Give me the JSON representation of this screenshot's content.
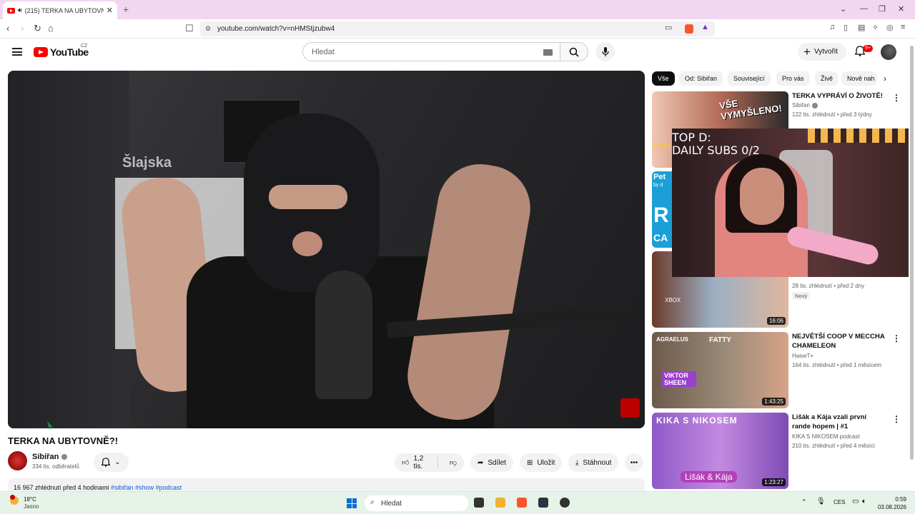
{
  "browser": {
    "tab_title": "(215) TERKA NA UBYTOVNĚ?!",
    "url": "youtube.com/watch?v=nHMStjzubw4"
  },
  "header": {
    "logo_text": "YouTube",
    "country_code": "CZ",
    "search_placeholder": "Hledat",
    "create_label": "Vytvořit",
    "notifications_count": "9+"
  },
  "video": {
    "title": "TERKA NA UBYTOVNĚ?!",
    "channel": "Sibiřan",
    "subscribers": "334 tis. odběratelů",
    "likes": "1,2 tis.",
    "share_label": "Sdílet",
    "save_label": "Uložit",
    "download_label": "Stáhnout",
    "views_time": "16 967 zhlédnutí  před 4 hodinami",
    "hashtags": "#sibiřan #show #podcast"
  },
  "chips": [
    "Vše",
    "Od: Sibiřan",
    "Související",
    "Pro vás",
    "Živě",
    "Nově nah"
  ],
  "recommendations": [
    {
      "title": "TERKA VYPRÁVÍ O ŽIVOTĚ!",
      "channel": "Sibiřan",
      "meta": "122 tis. zhlédnutí • před 3 týdny",
      "thumb_text": "VŠE VYMYŠLENO!",
      "thumb_side_text": "O DĚT"
    },
    {
      "thumb_text": "Pet",
      "thumb_big": "R",
      "thumb_sub": "CA",
      "thumb_by": "by d"
    },
    {
      "meta": "28 tis. zhlédnutí • před 2 dny",
      "badge": "Nový",
      "duration": "16:06",
      "thumb_text": "XBOX"
    },
    {
      "title": "NEJVĚTŠÍ COOP V MECCHA CHAMELEON",
      "channel": "HaiseT+",
      "meta": "164 tis. zhlédnutí • před 1 měsícem",
      "duration": "1:43:25",
      "thumb_label1": "AGRAELUS",
      "thumb_label2": "FATTY",
      "thumb_label3": "VIKTOR SHEEN"
    },
    {
      "title": "Lišák a Kája vzali první rande hopem | #1",
      "channel": "KIKA S NIKOSEM podcast",
      "meta": "210 tis. zhlédnutí • před 4 měsíci",
      "duration": "1:23:27",
      "thumb_text": "KIKA S NIKOSEM",
      "thumb_badge": "Lišák & Kája"
    }
  ],
  "stream_overlay": {
    "line1": "TOP D:",
    "line2": "DAILY SUBS 0/2"
  },
  "player": {
    "sign_text": "Šlajska"
  },
  "taskbar": {
    "temp": "18°C",
    "weather": "Jasno",
    "search_placeholder": "Hledat",
    "lang": "CES",
    "time": "0:59",
    "date": "03.08.2026"
  },
  "colors": {
    "tab_bar": "#f3d6ef",
    "youtube_red": "#ff0000",
    "taskbar": "#e7f3e9"
  }
}
